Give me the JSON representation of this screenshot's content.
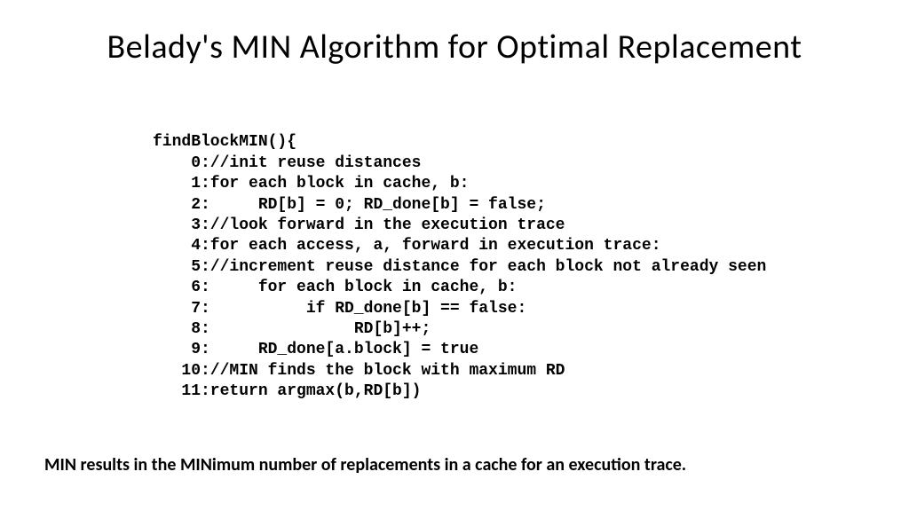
{
  "title": "Belady's MIN Algorithm for Optimal Replacement",
  "code": {
    "fn": "findBlockMIN(){",
    "l0": "    0://init reuse distances",
    "l1": "    1:for each block in cache, b:",
    "l2": "    2:     RD[b] = 0; RD_done[b] = false;",
    "l3": "    3://look forward in the execution trace",
    "l4": "    4:for each access, a, forward in execution trace:",
    "l5": "    5://increment reuse distance for each block not already seen",
    "l6": "    6:     for each block in cache, b:",
    "l7": "    7:          if RD_done[b] == false:",
    "l8": "    8:               RD[b]++;",
    "l9": "    9:     RD_done[a.block] = true",
    "l10": "   10://MIN finds the block with maximum RD",
    "l11": "   11:return argmax(b,RD[b])"
  },
  "bottom": "MIN results in the MINimum number of replacements in a cache for an execution trace."
}
